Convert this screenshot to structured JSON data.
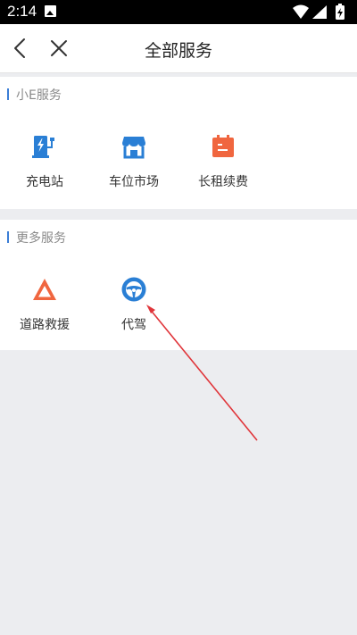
{
  "status": {
    "time": "2:14"
  },
  "header": {
    "title": "全部服务"
  },
  "sections": [
    {
      "title": "小E服务",
      "items": [
        {
          "label": "充电站",
          "icon": "charging-station-icon",
          "color": "#2a7fd5"
        },
        {
          "label": "车位市场",
          "icon": "parking-shop-icon",
          "color": "#2a7fd5"
        },
        {
          "label": "长租续费",
          "icon": "calendar-icon",
          "color": "#f0663f"
        }
      ]
    },
    {
      "title": "更多服务",
      "items": [
        {
          "label": "道路救援",
          "icon": "warning-triangle-icon",
          "color": "#f0663f"
        },
        {
          "label": "代驾",
          "icon": "steering-wheel-icon",
          "color": "#2a7fd5"
        }
      ]
    }
  ],
  "colors": {
    "accent": "#3b7ed6",
    "orange": "#f0663f",
    "annotation": "#e0353a"
  }
}
